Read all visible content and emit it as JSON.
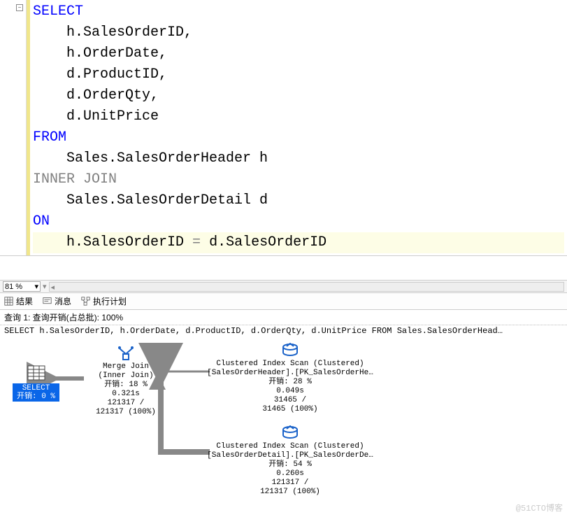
{
  "code": {
    "fold_symbol": "−",
    "lines": [
      {
        "indent": 0,
        "segs": [
          {
            "t": "SELECT",
            "c": "kw"
          }
        ]
      },
      {
        "indent": 1,
        "segs": [
          {
            "t": "h.SalesOrderID,"
          }
        ]
      },
      {
        "indent": 1,
        "segs": [
          {
            "t": "h.OrderDate,"
          }
        ]
      },
      {
        "indent": 1,
        "segs": [
          {
            "t": "d.ProductID,"
          }
        ]
      },
      {
        "indent": 1,
        "segs": [
          {
            "t": "d.OrderQty,"
          }
        ]
      },
      {
        "indent": 1,
        "segs": [
          {
            "t": "d.UnitPrice"
          }
        ]
      },
      {
        "indent": 0,
        "segs": [
          {
            "t": "FROM",
            "c": "kw"
          }
        ]
      },
      {
        "indent": 1,
        "segs": [
          {
            "t": "Sales.SalesOrderHeader h"
          }
        ]
      },
      {
        "indent": 0,
        "segs": [
          {
            "t": "INNER",
            "c": "gray"
          },
          {
            "t": " "
          },
          {
            "t": "JOIN",
            "c": "gray"
          }
        ]
      },
      {
        "indent": 1,
        "segs": [
          {
            "t": "Sales.SalesOrderDetail d"
          }
        ]
      },
      {
        "indent": 0,
        "segs": [
          {
            "t": "ON",
            "c": "kw"
          }
        ]
      },
      {
        "indent": 1,
        "segs": [
          {
            "t": "h.SalesOrderID "
          },
          {
            "t": "=",
            "c": "gray"
          },
          {
            "t": " d.SalesOrderID"
          }
        ],
        "highlight": true
      }
    ]
  },
  "zoom": {
    "value": "81 %"
  },
  "tabs": {
    "results": "结果",
    "messages": "消息",
    "execution_plan": "执行计划"
  },
  "query_header": {
    "label": "查询 1: 查询开销(占总批): ",
    "pct": "100%",
    "sql": "SELECT h.SalesOrderID, h.OrderDate, d.ProductID, d.OrderQty, d.UnitPrice FROM Sales.SalesOrderHead…"
  },
  "plan": {
    "select": {
      "title": "SELECT",
      "cost": "开销: 0 %"
    },
    "merge": {
      "title": "Merge Join",
      "sub": "(Inner Join)",
      "cost": "开销: 18 %",
      "time": "0.321s",
      "rows1": "121317 /",
      "rows2": "121317 (100%)"
    },
    "scan1": {
      "title": "Clustered Index Scan (Clustered)",
      "obj": "[SalesOrderHeader].[PK_SalesOrderHe…",
      "cost": "开销: 28 %",
      "time": "0.049s",
      "rows1": "31465 /",
      "rows2": "31465 (100%)"
    },
    "scan2": {
      "title": "Clustered Index Scan (Clustered)",
      "obj": "[SalesOrderDetail].[PK_SalesOrderDe…",
      "cost": "开销: 54 %",
      "time": "0.260s",
      "rows1": "121317 /",
      "rows2": "121317 (100%)"
    }
  },
  "watermark": "@51CTO博客"
}
